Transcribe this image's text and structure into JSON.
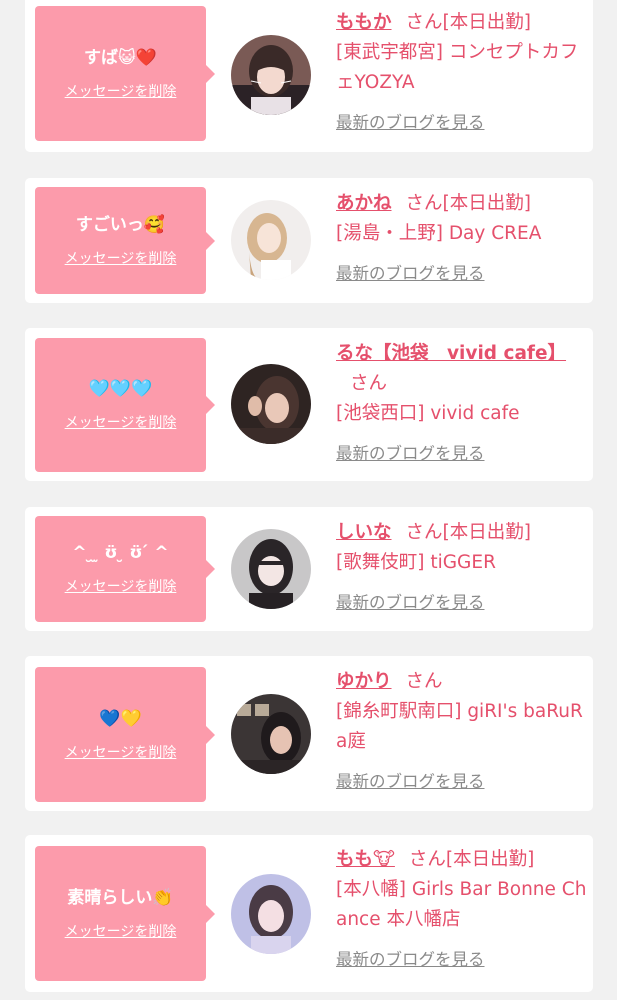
{
  "colors": {
    "accent": "#e5506c",
    "bubble": "#fc9bab",
    "background": "#f1f1f1",
    "card": "#ffffff",
    "muted": "#8a8a8a"
  },
  "items": [
    {
      "message": "すば😺❤️",
      "delete_label": "メッセージを削除",
      "name": "ももか",
      "suffix": "さん[本日出勤]",
      "shop": "[東武宇都宮] コンセプトカフェYOZYA",
      "blog_label": "最新のブログを見る",
      "avatar": "avatar-momoka"
    },
    {
      "message": "すごいっ🥰",
      "delete_label": "メッセージを削除",
      "name": "あかね",
      "suffix": "さん[本日出勤]",
      "shop": "[湯島・上野] Day CREA",
      "blog_label": "最新のブログを見る",
      "avatar": "avatar-akane"
    },
    {
      "message": "🩵🩵🩵",
      "delete_label": "メッセージを削除",
      "name": "るな【池袋　vivid cafe】",
      "suffix": "さん",
      "shop": "[池袋西口] vivid cafe",
      "blog_label": "最新のブログを見る",
      "avatar": "avatar-runa"
    },
    {
      "message": "^ ̮ ̫ ʊ̈ ̮ ʊ̈ ́ ^",
      "delete_label": "メッセージを削除",
      "name": "しいな",
      "suffix": "さん[本日出勤]",
      "shop": "[歌舞伎町] tiGGER",
      "blog_label": "最新のブログを見る",
      "avatar": "avatar-shiina"
    },
    {
      "message": "💙💛",
      "delete_label": "メッセージを削除",
      "name": "ゆかり",
      "suffix": "さん",
      "shop": "[錦糸町駅南口] giRI's baRuRa庭",
      "blog_label": "最新のブログを見る",
      "avatar": "avatar-yukari"
    },
    {
      "message": "素晴らしい👏",
      "delete_label": "メッセージを削除",
      "name": "もも🐮",
      "suffix": "さん[本日出勤]",
      "shop": "[本八幡] Girls Bar Bonne Chance 本八幡店",
      "blog_label": "最新のブログを見る",
      "avatar": "avatar-momo"
    }
  ]
}
